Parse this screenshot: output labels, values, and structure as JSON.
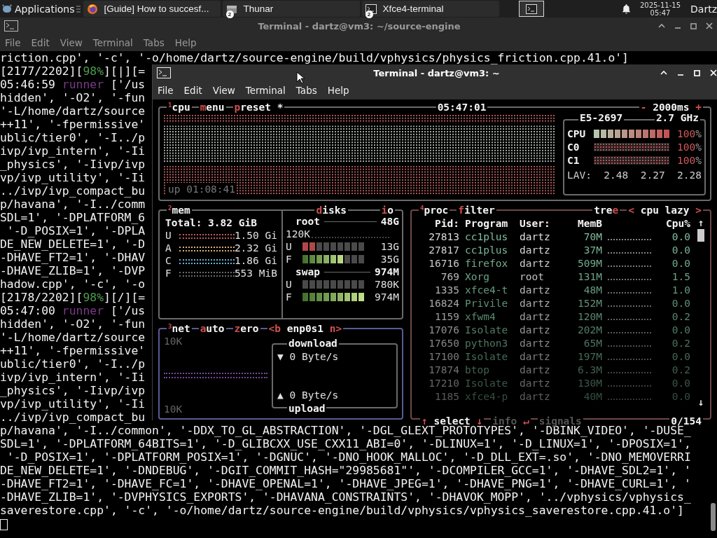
{
  "taskbar": {
    "menu_label": "Applications",
    "tasks": [
      {
        "kind": "browser",
        "label": "[Guide] How to succesf..."
      },
      {
        "kind": "files",
        "label": "Thunar",
        "badge": "2"
      },
      {
        "kind": "terminal",
        "label": "Xfce4-terminal",
        "badge": "2"
      }
    ],
    "date": "2025-11-15",
    "time": "05:47",
    "user": "Dartz"
  },
  "back_window": {
    "title": "Terminal - dartz@vm3: ~/source-engine",
    "menu": [
      "File",
      "Edit",
      "View",
      "Terminal",
      "Tabs",
      "Help"
    ],
    "lines": [
      {
        "kind": "text",
        "text": "riction.cpp', '-c', '-o/home/dartz/source-engine/build/vphysics/physics_friction.cpp.41.o']"
      },
      {
        "kind": "progress",
        "before": "[2177/2202][",
        "percent": "98%",
        "after": "][|][="
      },
      {
        "kind": "log",
        "time": "05:46:59 ",
        "tag": "runner",
        "after": " ['/us"
      },
      {
        "kind": "text",
        "text": "hidden', '-O2', '-fun"
      },
      {
        "kind": "text",
        "text": "'-L/home/dartz/source"
      },
      {
        "kind": "text",
        "text": "++11', '-fpermissive'"
      },
      {
        "kind": "text",
        "text": "ublic/tier0', '-I../p"
      },
      {
        "kind": "text",
        "text": "ivp/ivp_intern', '-Ii"
      },
      {
        "kind": "text",
        "text": "_physics', '-Iivp/ivp"
      },
      {
        "kind": "text",
        "text": "vp/ivp_utility', '-Ii"
      },
      {
        "kind": "text",
        "text": "../ivp/ivp_compact_bu"
      },
      {
        "kind": "text",
        "text": "p/havana', '-I../comm"
      },
      {
        "kind": "text",
        "text": "SDL=1', '-DPLATFORM_6"
      },
      {
        "kind": "text",
        "text": " '-D_POSIX=1', '-DPLA"
      },
      {
        "kind": "text",
        "text": "DE_NEW_DELETE=1', '-D"
      },
      {
        "kind": "text",
        "text": "-DHAVE_FT2=1', '-DHAV"
      },
      {
        "kind": "text",
        "text": "-DHAVE_ZLIB=1', '-DVP"
      },
      {
        "kind": "text",
        "text": "hadow.cpp', '-c', '-o"
      },
      {
        "kind": "progress",
        "before": "[2178/2202][",
        "percent": "98%",
        "after": "][/][="
      },
      {
        "kind": "log",
        "time": "05:47:00 ",
        "tag": "runner",
        "after": " ['/us"
      },
      {
        "kind": "text",
        "text": "hidden', '-O2', '-fun"
      },
      {
        "kind": "text",
        "text": "'-L/home/dartz/source"
      },
      {
        "kind": "text",
        "text": "++11', '-fpermissive'"
      },
      {
        "kind": "text",
        "text": "ublic/tier0', '-I../p"
      },
      {
        "kind": "text",
        "text": "ivp/ivp_intern', '-Ii"
      },
      {
        "kind": "text",
        "text": "_physics', '-Iivp/ivp"
      },
      {
        "kind": "text",
        "text": "vp/ivp_utility', '-Ii"
      },
      {
        "kind": "text",
        "text": "../ivp/ivp_compact_bu"
      },
      {
        "kind": "text",
        "text": "p/havana', '-I../common', '-DDX_TO_GL_ABSTRACTION', '-DGL_GLEXT_PROTOTYPES', '-DBINK_VIDEO', '-DUSE_"
      },
      {
        "kind": "text",
        "text": "SDL=1', '-DPLATFORM_64BITS=1', '-D_GLIBCXX_USE_CXX11_ABI=0', '-DLINUX=1', '-D_LINUX=1', '-DPOSIX=1',"
      },
      {
        "kind": "text",
        "text": " '-D_POSIX=1', '-DPLATFORM_POSIX=1', '-DGNUC', '-DNO_HOOK_MALLOC', '-D_DLL_EXT=.so', '-DNO_MEMOVERRI"
      },
      {
        "kind": "text",
        "text": "DE_NEW_DELETE=1', '-DNDEBUG', '-DGIT_COMMIT_HASH=\"29985681\"', '-DCOMPILER_GCC=1', '-DHAVE_SDL2=1', '"
      },
      {
        "kind": "text",
        "text": "-DHAVE_FT2=1', '-DHAVE_FC=1', '-DHAVE_OPENAL=1', '-DHAVE_JPEG=1', '-DHAVE_PNG=1', '-DHAVE_CURL=1', '"
      },
      {
        "kind": "text",
        "text": "-DHAVE_ZLIB=1', '-DVPHYSICS_EXPORTS', '-DHAVANA_CONSTRAINTS', '-DHAVOK_MOPP', '../vphysics/vphysics_"
      },
      {
        "kind": "text",
        "text": "saverestore.cpp', '-c', '-o/home/dartz/source-engine/build/vphysics/vphysics_saverestore.cpp.41.o']"
      },
      {
        "kind": "cursor"
      }
    ]
  },
  "front_window": {
    "title": "Terminal - dartz@vm3: ~",
    "menu": [
      "File",
      "Edit",
      "View",
      "Terminal",
      "Tabs",
      "Help"
    ],
    "btop": {
      "cpu": {
        "num": "1",
        "title": "cpu",
        "tabs": [
          [
            {
              "t": "m",
              "hot": true
            },
            {
              "t": "enu",
              "hot": false
            }
          ],
          [
            {
              "t": "p",
              "hot": true
            },
            {
              "t": "reset *",
              "hot": false
            }
          ]
        ],
        "clock": "05:47:01",
        "interval": [
          {
            "t": "-",
            "hot": true
          },
          {
            "t": " 2000ms ",
            "hot": false
          },
          {
            "t": "+",
            "hot": true
          }
        ],
        "uptime": "up 01:08:41",
        "model": "E5-2697",
        "freq": "2.7 GHz",
        "meters": [
          {
            "kind": "total",
            "label": "CPU",
            "level": 1,
            "value": "100",
            "unit": "%"
          },
          {
            "kind": "core",
            "label": "C0",
            "level": 1,
            "value": "100",
            "unit": "%"
          },
          {
            "kind": "core",
            "label": "C1",
            "level": 1,
            "value": "100",
            "unit": "%"
          }
        ],
        "lav_label": "LAV:",
        "lav": [
          "2.48",
          "2.27",
          "2.28"
        ]
      },
      "mem": {
        "num": "2",
        "title": "mem",
        "total": "Total: 3.82 GiB",
        "rows": [
          {
            "label": "U",
            "color": "#c05a5a",
            "reading": "1.50 Gi"
          },
          {
            "label": "A",
            "color": "#d8b070",
            "reading": "2.32 Gi"
          },
          {
            "label": "C",
            "color": "#6ab4d4",
            "reading": "1.86 Gi"
          },
          {
            "label": "F",
            "color": "#6a6a6a",
            "reading": "553 MiB"
          }
        ]
      },
      "disks": {
        "tabs": [
          [
            {
              "t": "d",
              "hot": true
            },
            {
              "t": "isks",
              "hot": false
            }
          ],
          [
            {
              "t": "i",
              "hot": true
            },
            {
              "t": "o",
              "hot": false
            }
          ]
        ],
        "groups": [
          {
            "name": "root",
            "size": "48G",
            "io": "120K",
            "bars": [
              {
                "kind": "used",
                "label": "U",
                "level": 0.2,
                "reading": "13G"
              },
              {
                "kind": "free",
                "label": "F",
                "level": 0.68,
                "reading": "35G"
              }
            ]
          },
          {
            "name": "swap",
            "size": "974M",
            "bars": [
              {
                "kind": "used",
                "label": "U",
                "level": 0,
                "reading": "780K"
              },
              {
                "kind": "free",
                "label": "F",
                "level": 1,
                "reading": "974M"
              }
            ]
          }
        ]
      },
      "net": {
        "num": "3",
        "title": "net",
        "tabs": [
          [
            {
              "t": "a",
              "hot": true
            },
            {
              "t": "uto",
              "hot": false
            }
          ],
          [
            {
              "t": "z",
              "hot": true
            },
            {
              "t": "ero",
              "hot": false
            }
          ],
          [
            {
              "t": "<b",
              "hot": true
            },
            {
              "t": " enp0s1 ",
              "hot": false
            },
            {
              "t": "n>",
              "hot": true
            }
          ]
        ],
        "scale_top": "10K",
        "scale_bottom": "10K",
        "download": {
          "label": "download",
          "arrow": "▼",
          "rate": "0 Byte/s"
        },
        "upload": {
          "label": "upload",
          "arrow": "▲",
          "rate": "0 Byte/s"
        }
      },
      "proc": {
        "num": "4",
        "title": "proc",
        "tabs": [
          [
            {
              "t": "f",
              "hot": true
            },
            {
              "t": "ilter",
              "hot": false
            }
          ],
          [
            {
              "t": "tre",
              "hot": false
            },
            {
              "t": "e",
              "hot": true
            }
          ],
          [
            {
              "t": "<",
              "hot": true
            },
            {
              "t": " cpu lazy ",
              "hot": false
            },
            {
              "t": ">",
              "hot": true
            }
          ]
        ],
        "columns": [
          "Pid:",
          "Program",
          "User:",
          "MemB",
          "Cpu%"
        ],
        "scroll_up": "↑",
        "scroll_down": "↓",
        "rows": [
          {
            "pid": "27813",
            "program": "cc1plus",
            "user": "dartz",
            "mem": "70M",
            "cpu": "0.0"
          },
          {
            "pid": "27817",
            "program": "cc1plus",
            "user": "dartz",
            "mem": "37M",
            "cpu": "0.0"
          },
          {
            "pid": "16716",
            "program": "firefox",
            "user": "dartz",
            "mem": "509M",
            "cpu": "0.0"
          },
          {
            "pid": "769",
            "program": "Xorg",
            "user": "root",
            "mem": "131M",
            "cpu": "1.5"
          },
          {
            "pid": "1335",
            "program": "xfce4-t",
            "user": "dartz",
            "mem": "48M",
            "cpu": "1.0"
          },
          {
            "pid": "16824",
            "program": "Privile",
            "user": "dartz",
            "mem": "152M",
            "cpu": "0.0"
          },
          {
            "pid": "1159",
            "program": "xfwm4",
            "user": "dartz",
            "mem": "120M",
            "cpu": "0.2"
          },
          {
            "pid": "17076",
            "program": "Isolate",
            "user": "dartz",
            "mem": "202M",
            "cpu": "0.0"
          },
          {
            "pid": "17650",
            "program": "python3",
            "user": "dartz",
            "mem": "65M",
            "cpu": "0.2"
          },
          {
            "pid": "17100",
            "program": "Isolate",
            "user": "dartz",
            "mem": "197M",
            "cpu": "0.0"
          },
          {
            "pid": "17874",
            "program": "btop",
            "user": "dartz",
            "mem": "6.3M",
            "cpu": "0.2"
          },
          {
            "pid": "17210",
            "program": "Isolate",
            "user": "dartz",
            "mem": "130M",
            "cpu": "0.0"
          },
          {
            "pid": "1185",
            "program": "xfce4-p",
            "user": "dartz",
            "mem": "40M",
            "cpu": "0.0"
          }
        ],
        "footer": [
          {
            "disabled": false,
            "segs": [
              {
                "t": "↑",
                "hot": true
              },
              {
                "t": " select ",
                "hot": false
              },
              {
                "t": "↓",
                "hot": true
              }
            ]
          },
          {
            "disabled": true,
            "segs": [
              {
                "t": "info ",
                "hot": false
              },
              {
                "t": "↵",
                "hot": true
              }
            ]
          },
          {
            "disabled": true,
            "segs": [
              {
                "t": "signals",
                "hot": false
              }
            ]
          }
        ],
        "count": "0/154"
      }
    }
  }
}
